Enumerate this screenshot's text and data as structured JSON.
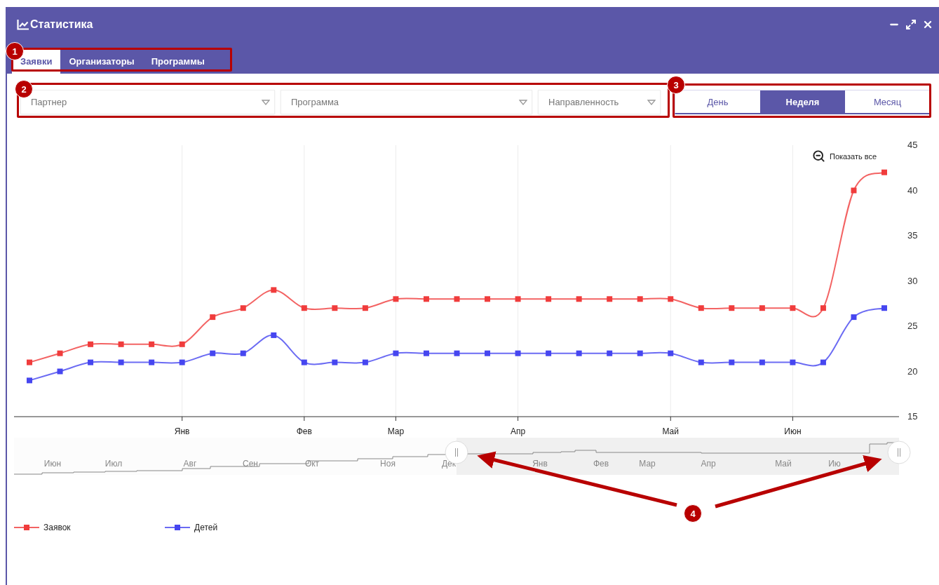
{
  "window": {
    "title": "Статистика"
  },
  "tabs": [
    {
      "label": "Заявки",
      "selected": true
    },
    {
      "label": "Организаторы",
      "selected": false
    },
    {
      "label": "Программы",
      "selected": false
    }
  ],
  "filters": [
    {
      "placeholder": "Партнер"
    },
    {
      "placeholder": "Программа"
    },
    {
      "placeholder": "Направленность"
    }
  ],
  "period": [
    {
      "label": "День",
      "selected": false
    },
    {
      "label": "Неделя",
      "selected": true
    },
    {
      "label": "Месяц",
      "selected": false
    }
  ],
  "chart": {
    "reset_zoom": "Показать все",
    "chart_data": {
      "type": "line",
      "categories": [
        null,
        null,
        null,
        null,
        null,
        "Янв",
        null,
        null,
        null,
        "Фев",
        null,
        null,
        "Мар",
        null,
        null,
        null,
        "Апр",
        null,
        null,
        null,
        null,
        "Май",
        null,
        null,
        null,
        "Июн",
        null,
        null,
        null
      ],
      "grid": true,
      "series": [
        {
          "name": "Заявок",
          "color": "#f03c3c",
          "marker": "square",
          "values": [
            21,
            22,
            23,
            23,
            23,
            23,
            26,
            27,
            29,
            27,
            27,
            27,
            28,
            28,
            28,
            28,
            28,
            28,
            28,
            28,
            28,
            28,
            27,
            27,
            27,
            27,
            27,
            40,
            42
          ]
        },
        {
          "name": "Детей",
          "color": "#4646f0",
          "marker": "square",
          "values": [
            19,
            20,
            21,
            21,
            21,
            21,
            22,
            22,
            24,
            21,
            21,
            21,
            22,
            22,
            22,
            22,
            22,
            22,
            22,
            22,
            22,
            22,
            21,
            21,
            21,
            21,
            21,
            26,
            27
          ]
        }
      ],
      "ylim": [
        15,
        45
      ],
      "yticks": [
        15,
        20,
        25,
        30,
        35,
        40,
        45
      ]
    },
    "navigator": {
      "labels": [
        "Июн",
        "Июл",
        "Авг",
        "Сен",
        "Окт",
        "Ноя",
        "Дек",
        "Янв",
        "Фев",
        "Мар",
        "Апр",
        "Май",
        "Ию"
      ]
    }
  },
  "callouts": [
    {
      "number": "1"
    },
    {
      "number": "2"
    },
    {
      "number": "3"
    },
    {
      "number": "4"
    }
  ]
}
